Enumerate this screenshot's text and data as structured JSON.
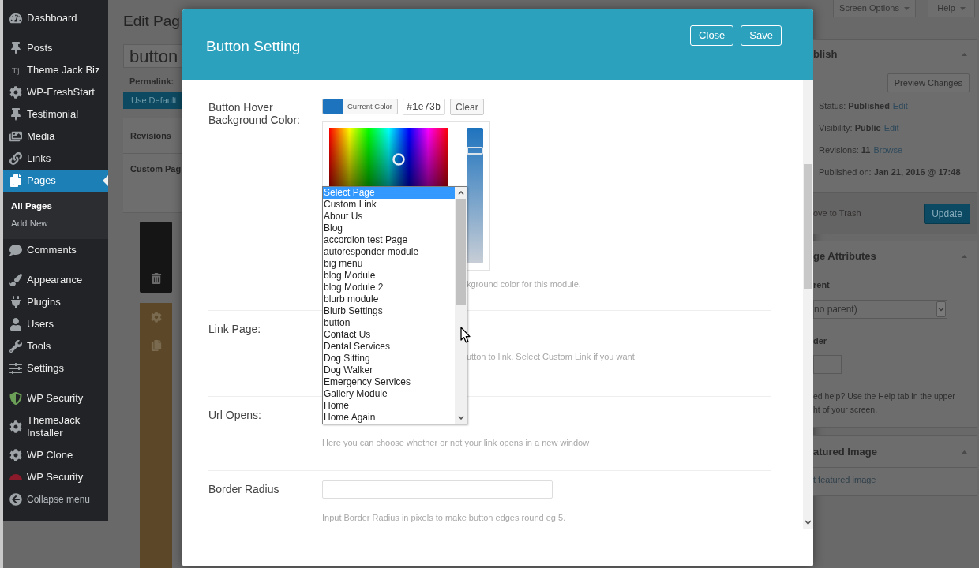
{
  "sidebar": {
    "groups": [
      [
        {
          "label": "Dashboard",
          "selected": false
        }
      ],
      [
        {
          "label": "Posts",
          "selected": false
        },
        {
          "label": "Theme Jack Biz",
          "selected": false,
          "icon_text": "Tj"
        },
        {
          "label": "WP-FreshStart",
          "selected": false
        },
        {
          "label": "Testimonial",
          "selected": false
        },
        {
          "label": "Media",
          "selected": false
        },
        {
          "label": "Links",
          "selected": false
        },
        {
          "label": "Pages",
          "selected": true,
          "children": [
            {
              "label": "All Pages",
              "selected": true
            },
            {
              "label": "Add New",
              "selected": false
            }
          ]
        },
        {
          "label": "Comments",
          "selected": false
        }
      ],
      [
        {
          "label": "Appearance",
          "selected": false
        },
        {
          "label": "Plugins",
          "selected": false
        },
        {
          "label": "Users",
          "selected": false
        },
        {
          "label": "Tools",
          "selected": false
        },
        {
          "label": "Settings",
          "selected": false
        }
      ],
      [
        {
          "label": "WP Security",
          "selected": false
        },
        {
          "label": "ThemeJack Installer",
          "selected": false
        },
        {
          "label": "WP Clone",
          "selected": false
        },
        {
          "label": "WP Security",
          "selected": false
        }
      ]
    ],
    "collapse": "Collapse menu"
  },
  "editor": {
    "heading": "Edit Pag",
    "title_value": "button",
    "permalink_label": "Permalink:",
    "default_button": "Use Default",
    "boxes": [
      "Revisions",
      "Custom Pag"
    ]
  },
  "modal": {
    "title": "Button Setting",
    "actions": [
      "Close",
      "Save"
    ],
    "fields": [
      {
        "kind": "color",
        "label": "Button Hover Background Color:",
        "color": "#1e73be",
        "swatch_label": "Current Color",
        "value": "#1e73b",
        "clear": "Clear",
        "level": 0.83,
        "description": "kground color for this module."
      },
      {
        "kind": "select",
        "label": "Link Page:",
        "expanded": true,
        "description": "utton to link. Select Custom Link if you want",
        "options": [
          {
            "label": "Select Page",
            "selected": true
          },
          {
            "label": "Custom Link",
            "selected": false
          },
          {
            "label": "About Us",
            "selected": false
          },
          {
            "label": "Blog",
            "selected": false
          },
          {
            "label": "accordion test Page",
            "selected": false
          },
          {
            "label": "autoresponder module",
            "selected": false
          },
          {
            "label": "big menu",
            "selected": false
          },
          {
            "label": "blog Module",
            "selected": false
          },
          {
            "label": "blog Module 2",
            "selected": false
          },
          {
            "label": "blurb module",
            "selected": false
          },
          {
            "label": "Blurb Settings",
            "selected": false
          },
          {
            "label": "button",
            "selected": false
          },
          {
            "label": "Contact Us",
            "selected": false
          },
          {
            "label": "Dental Services",
            "selected": false
          },
          {
            "label": "Dog Sitting",
            "selected": false
          },
          {
            "label": "Dog Walker",
            "selected": false
          },
          {
            "label": "Emergency Services",
            "selected": false
          },
          {
            "label": "Gallery Module",
            "selected": false
          },
          {
            "label": "Home",
            "selected": false
          },
          {
            "label": "Home Again",
            "selected": false
          }
        ]
      },
      {
        "kind": "select",
        "label": "Url Opens:",
        "description": "Here you can choose whether or not your link opens in a new window"
      },
      {
        "kind": "text",
        "label": "Border Radius",
        "description": "Input Border Radius in pixels to make button edges round eg 5."
      }
    ]
  },
  "screen_tabs": [
    {
      "label": "Screen Options"
    },
    {
      "label": "Help"
    }
  ],
  "publish": {
    "title": "blish",
    "preview_button": "Preview Changes",
    "rows": [
      {
        "text": "Status: **Published**",
        "link": "Edit"
      },
      {
        "text": "Visibility: **Public**",
        "link": "Edit"
      },
      {
        "text": "Revisions: **11**",
        "link": "Browse"
      },
      {
        "text": "Published on: **Jan 21, 2016 @ 17:48**"
      }
    ],
    "trash_link": "ove to Trash",
    "update_button": "Update"
  },
  "page_attributes": {
    "title": "ge Attributes",
    "parent_label": "rent",
    "parent_value": "no parent)",
    "order_label": "der",
    "help_lines": [
      "ed help? Use the Help tab in the upper",
      "ht of your screen."
    ]
  },
  "featured_image": {
    "title": "atured Image",
    "link": "t featured image"
  }
}
